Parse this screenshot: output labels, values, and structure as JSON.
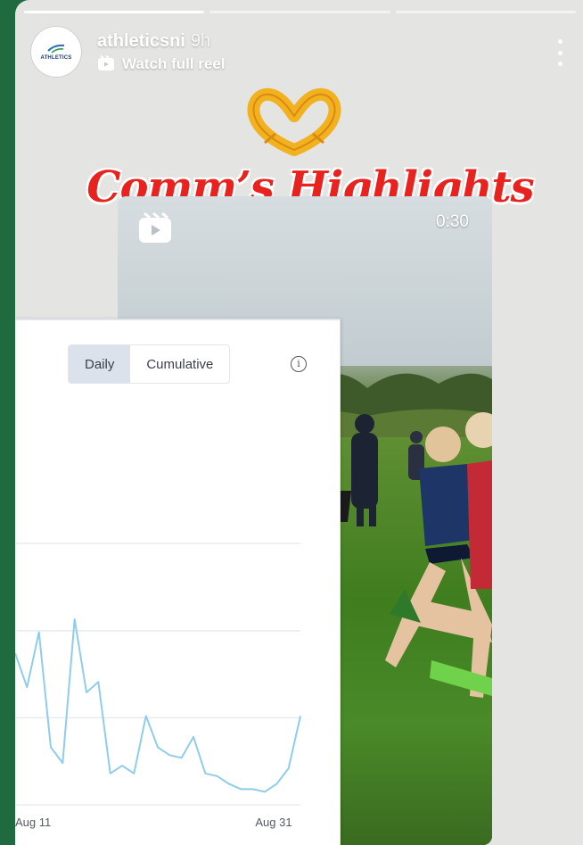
{
  "story": {
    "username": "athleticsni",
    "time": "9h",
    "watch_label": "Watch full reel",
    "avatar_text": "ATHLETICS",
    "headline": "Comm’s Highlights",
    "progress_segments": 3,
    "active_segment": 0
  },
  "reel": {
    "duration": "0:30"
  },
  "chart_widget": {
    "toggle": [
      "Daily",
      "Cumulative"
    ],
    "selected": "Daily",
    "info_glyph": "i"
  },
  "chart_data": {
    "type": "line",
    "x_tick_labels": [
      "Aug 11",
      "Aug 31"
    ],
    "values": [
      58,
      45,
      66,
      22,
      16,
      71,
      43,
      47,
      12,
      15,
      12,
      34,
      22,
      19,
      18,
      26,
      12,
      11,
      8,
      6,
      6,
      5,
      8,
      14,
      34
    ],
    "line_color": "#8fcdea",
    "grid": true,
    "ylim": [
      0,
      100
    ]
  },
  "colors": {
    "headline": "#e8231f",
    "toggle_selected_bg": "#dbe2ec",
    "background_green": "#1f6b3f"
  }
}
